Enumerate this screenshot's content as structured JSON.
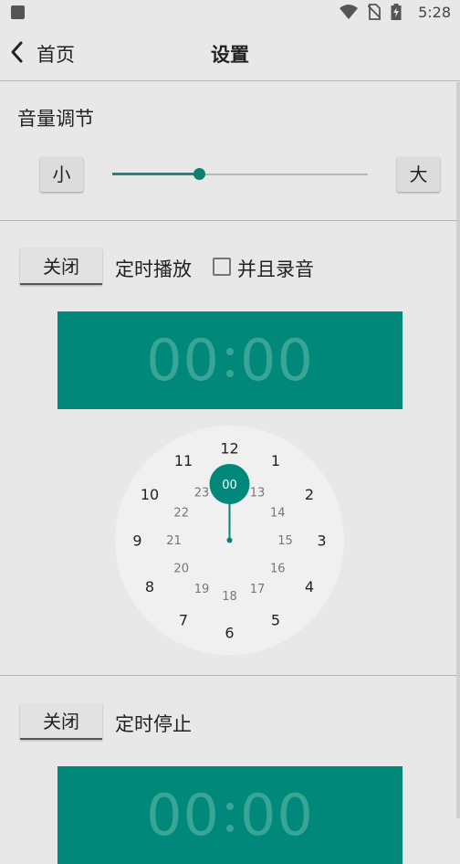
{
  "statusbar": {
    "time": "5:28",
    "icons": [
      "square-icon",
      "wifi-icon",
      "no-sim-icon",
      "battery-icon"
    ]
  },
  "appbar": {
    "back_label": "首页",
    "title": "设置"
  },
  "volume": {
    "title": "音量调节",
    "min_label": "小",
    "max_label": "大",
    "level_fraction": 0.34
  },
  "timer_play": {
    "toggle_label": "关闭",
    "label": "定时播放",
    "record_checked": false,
    "record_label": "并且录音",
    "hours": "00",
    "minutes": "00"
  },
  "clock_picker": {
    "selected_label": "00",
    "outer_numbers": [
      "12",
      "1",
      "2",
      "3",
      "4",
      "5",
      "6",
      "7",
      "8",
      "9",
      "10",
      "11"
    ],
    "inner_numbers": [
      "00",
      "13",
      "14",
      "15",
      "16",
      "17",
      "18",
      "19",
      "20",
      "21",
      "22",
      "23"
    ]
  },
  "timer_stop": {
    "toggle_label": "关闭",
    "label": "定时停止",
    "hours": "00",
    "minutes": "00"
  },
  "colors": {
    "accent": "#00897b",
    "time_digits": "#39a596",
    "clock_face": "#f0f0f0"
  }
}
